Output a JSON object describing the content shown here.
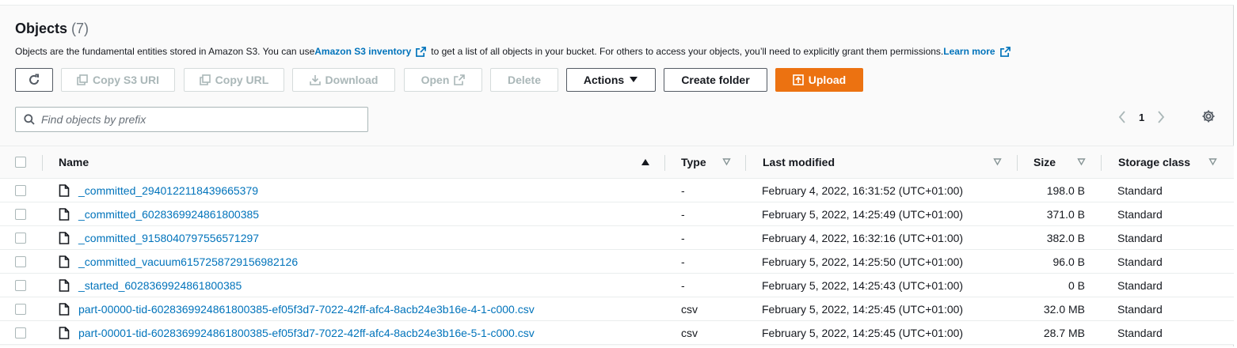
{
  "header": {
    "title": "Objects",
    "count": "(7)",
    "description_pre": "Objects are the fundamental entities stored in Amazon S3. You can use ",
    "inventory_link": "Amazon S3 inventory",
    "description_mid": " to get a list of all objects in your bucket. For others to access your objects, you’ll need to explicitly grant them permissions. ",
    "learn_more": "Learn more"
  },
  "toolbar": {
    "refresh_icon": "refresh-icon",
    "copy_s3_uri": "Copy S3 URI",
    "copy_url": "Copy URL",
    "download": "Download",
    "open": "Open",
    "delete": "Delete",
    "actions": "Actions",
    "create_folder": "Create folder",
    "upload": "Upload"
  },
  "search": {
    "placeholder": "Find objects by prefix"
  },
  "pagination": {
    "current_page": "1"
  },
  "table": {
    "columns": {
      "name": "Name",
      "type": "Type",
      "last_modified": "Last modified",
      "size": "Size",
      "storage_class": "Storage class"
    },
    "rows": [
      {
        "name": "_committed_2940122118439665379",
        "type": "-",
        "last_modified": "February 4, 2022, 16:31:52 (UTC+01:00)",
        "size": "198.0 B",
        "storage_class": "Standard"
      },
      {
        "name": "_committed_6028369924861800385",
        "type": "-",
        "last_modified": "February 5, 2022, 14:25:49 (UTC+01:00)",
        "size": "371.0 B",
        "storage_class": "Standard"
      },
      {
        "name": "_committed_9158040797556571297",
        "type": "-",
        "last_modified": "February 4, 2022, 16:32:16 (UTC+01:00)",
        "size": "382.0 B",
        "storage_class": "Standard"
      },
      {
        "name": "_committed_vacuum6157258729156982126",
        "type": "-",
        "last_modified": "February 5, 2022, 14:25:50 (UTC+01:00)",
        "size": "96.0 B",
        "storage_class": "Standard"
      },
      {
        "name": "_started_6028369924861800385",
        "type": "-",
        "last_modified": "February 5, 2022, 14:25:43 (UTC+01:00)",
        "size": "0 B",
        "storage_class": "Standard"
      },
      {
        "name": "part-00000-tid-6028369924861800385-ef05f3d7-7022-42ff-afc4-8acb24e3b16e-4-1-c000.csv",
        "type": "csv",
        "last_modified": "February 5, 2022, 14:25:45 (UTC+01:00)",
        "size": "32.0 MB",
        "storage_class": "Standard"
      },
      {
        "name": "part-00001-tid-6028369924861800385-ef05f3d7-7022-42ff-afc4-8acb24e3b16e-5-1-c000.csv",
        "type": "csv",
        "last_modified": "February 5, 2022, 14:25:45 (UTC+01:00)",
        "size": "28.7 MB",
        "storage_class": "Standard"
      }
    ]
  },
  "colors": {
    "link": "#0073bb",
    "primary": "#ec7211",
    "disabled": "#aab7b8",
    "text": "#16191f"
  }
}
